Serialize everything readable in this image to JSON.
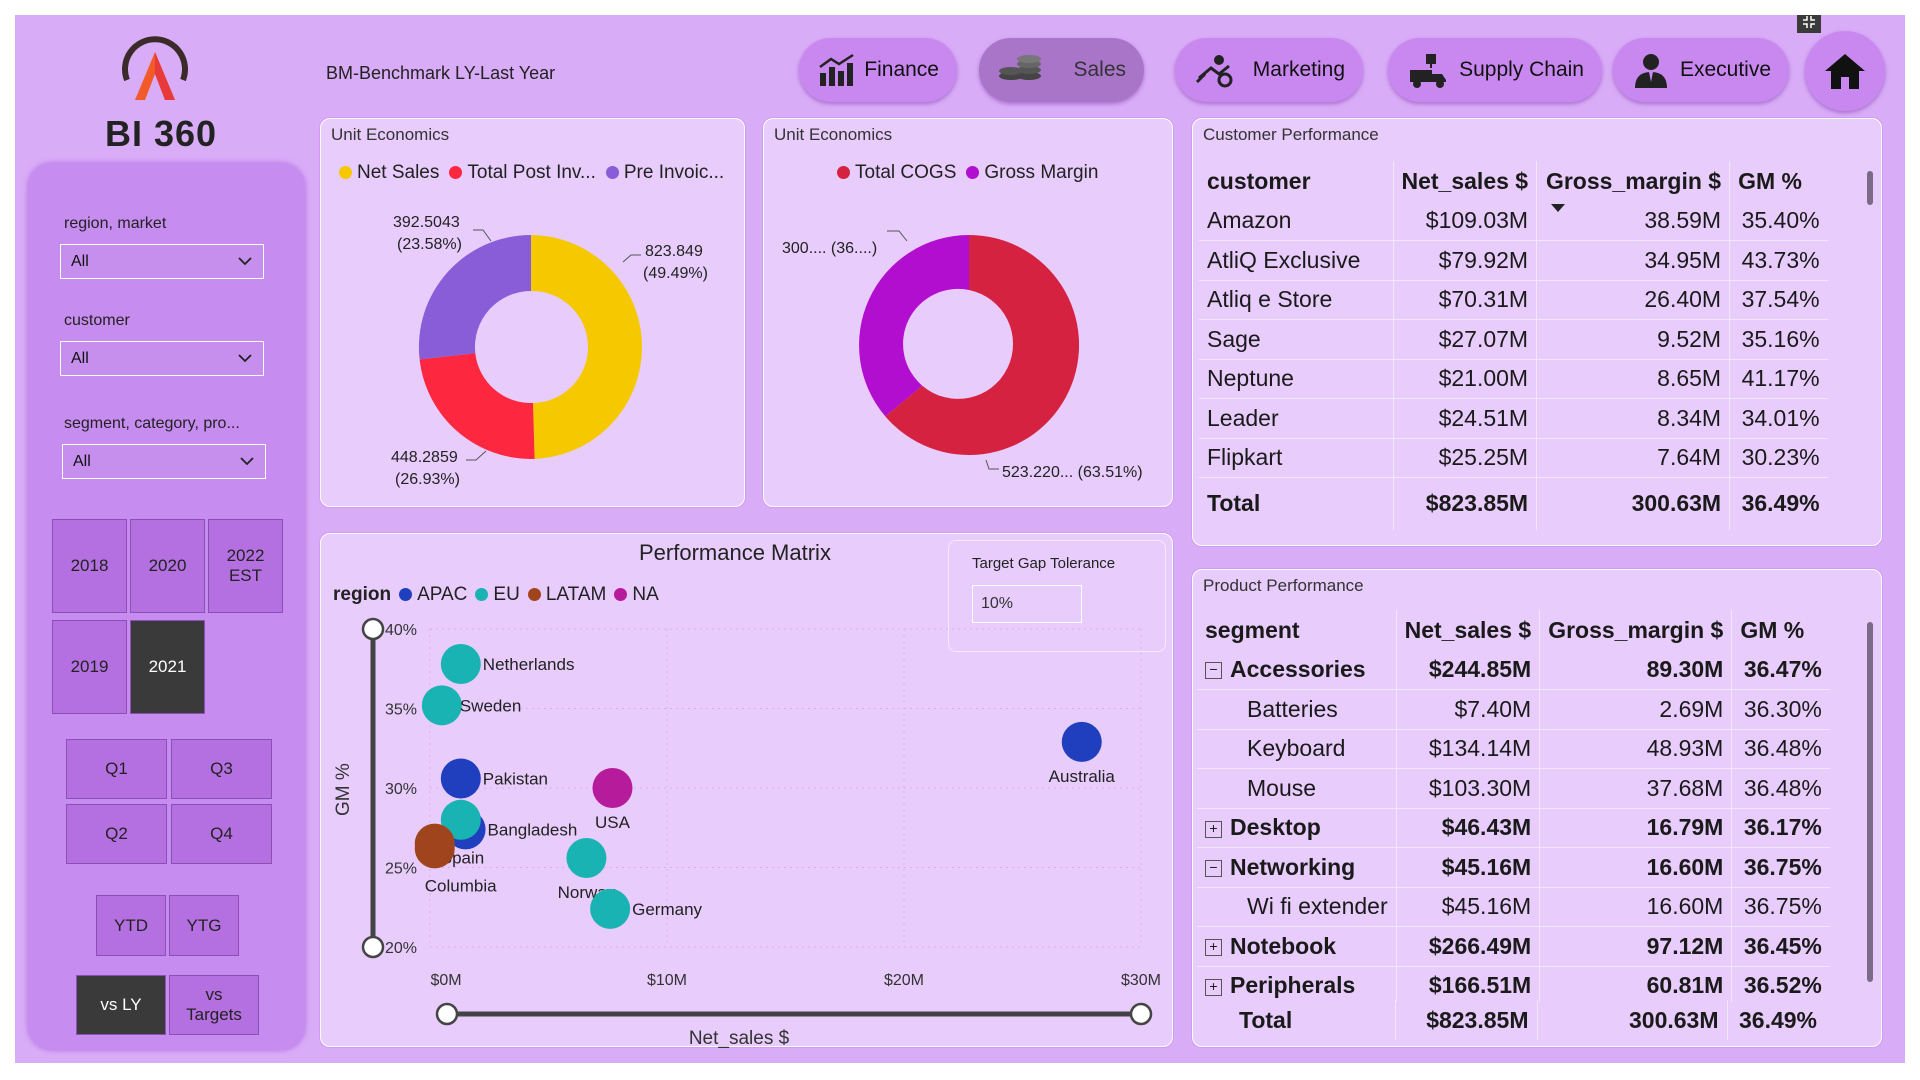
{
  "app": {
    "logo_text": "BI 360",
    "benchmark_note": "BM-Benchmark LY-Last Year"
  },
  "nav": [
    {
      "label": "Finance",
      "icon": "finance-chart-icon"
    },
    {
      "label": "Sales",
      "icon": "coins-icon"
    },
    {
      "label": "Marketing",
      "icon": "marketing-icon"
    },
    {
      "label": "Supply Chain",
      "icon": "supply-chain-icon"
    },
    {
      "label": "Executive",
      "icon": "executive-icon"
    },
    {
      "label": "",
      "icon": "home-icon"
    }
  ],
  "filters": {
    "region": {
      "label": "region, market",
      "value": "All"
    },
    "customer": {
      "label": "customer",
      "value": "All"
    },
    "segment": {
      "label": "segment, category, pro...",
      "value": "All"
    }
  },
  "years": [
    "2018",
    "2020",
    "2022 EST",
    "2019",
    "2021"
  ],
  "selected_year": "2021",
  "quarters": [
    "Q1",
    "Q3",
    "Q2",
    "Q4"
  ],
  "periods": [
    "YTD",
    "YTG"
  ],
  "compare": [
    "vs LY",
    "vs Targets"
  ],
  "selected_compare": "vs LY",
  "colors": {
    "accent": "#d9acf7",
    "yellow": "#f5c800",
    "red": "#fd2740",
    "violet": "#8a5dd8",
    "cogs": "#d42240",
    "margin": "#b10ed0",
    "apac": "#1f3fbf",
    "eu": "#19b3b3",
    "latam": "#a0441e",
    "na": "#b51b9a"
  },
  "unit_econ_1": {
    "title": "Unit Economics",
    "legend": [
      "Net Sales",
      "Total Post Inv...",
      "Pre Invoic..."
    ],
    "labels": {
      "net_sales": [
        "823.849",
        "(49.49%)"
      ],
      "post_inv": [
        "448.2859",
        "(26.93%)"
      ],
      "pre_inv": [
        "392.5043",
        "(23.58%)"
      ]
    }
  },
  "unit_econ_2": {
    "title": "Unit Economics",
    "legend": [
      "Total COGS",
      "Gross Margin"
    ],
    "labels": {
      "cogs": "523.220... (63.51%)",
      "margin": "300.... (36....)"
    }
  },
  "customer_perf": {
    "title": "Customer Performance",
    "columns": [
      "customer",
      "Net_sales $",
      "Gross_margin $",
      "GM %"
    ],
    "rows": [
      [
        "Amazon",
        "$109.03M",
        "38.59M",
        "35.40%"
      ],
      [
        "AtliQ Exclusive",
        "$79.92M",
        "34.95M",
        "43.73%"
      ],
      [
        "Atliq e Store",
        "$70.31M",
        "26.40M",
        "37.54%"
      ],
      [
        "Sage",
        "$27.07M",
        "9.52M",
        "35.16%"
      ],
      [
        "Neptune",
        "$21.00M",
        "8.65M",
        "41.17%"
      ],
      [
        "Leader",
        "$24.51M",
        "8.34M",
        "34.01%"
      ],
      [
        "Flipkart",
        "$25.25M",
        "7.64M",
        "30.23%"
      ]
    ],
    "total": [
      "Total",
      "$823.85M",
      "300.63M",
      "36.49%"
    ]
  },
  "product_perf": {
    "title": "Product Performance",
    "columns": [
      "segment",
      "Net_sales $",
      "Gross_margin $",
      "GM %"
    ],
    "rows": [
      {
        "name": "Accessories",
        "vals": [
          "$244.85M",
          "89.30M",
          "36.47%"
        ],
        "level": 0,
        "exp": "−"
      },
      {
        "name": "Batteries",
        "vals": [
          "$7.40M",
          "2.69M",
          "36.30%"
        ],
        "level": 1,
        "exp": ""
      },
      {
        "name": "Keyboard",
        "vals": [
          "$134.14M",
          "48.93M",
          "36.48%"
        ],
        "level": 1,
        "exp": ""
      },
      {
        "name": "Mouse",
        "vals": [
          "$103.30M",
          "37.68M",
          "36.48%"
        ],
        "level": 1,
        "exp": ""
      },
      {
        "name": "Desktop",
        "vals": [
          "$46.43M",
          "16.79M",
          "36.17%"
        ],
        "level": 0,
        "exp": "+"
      },
      {
        "name": "Networking",
        "vals": [
          "$45.16M",
          "16.60M",
          "36.75%"
        ],
        "level": 0,
        "exp": "−"
      },
      {
        "name": "Wi fi extender",
        "vals": [
          "$45.16M",
          "16.60M",
          "36.75%"
        ],
        "level": 1,
        "exp": ""
      },
      {
        "name": "Notebook",
        "vals": [
          "$266.49M",
          "97.12M",
          "36.45%"
        ],
        "level": 0,
        "exp": "+"
      },
      {
        "name": "Peripherals",
        "vals": [
          "$166.51M",
          "60.81M",
          "36.52%"
        ],
        "level": 0,
        "exp": "+"
      }
    ],
    "total": [
      "Total",
      "$823.85M",
      "300.63M",
      "36.49%"
    ]
  },
  "matrix": {
    "title": "Performance Matrix",
    "legend_title": "region",
    "tolerance_label": "Target Gap Tolerance",
    "tolerance_value": "10%"
  },
  "chart_data": [
    {
      "type": "pie",
      "title": "Unit Economics",
      "categories": [
        "Net Sales",
        "Total Post Inv...",
        "Pre Invoic..."
      ],
      "values": [
        823.849,
        448.2859,
        392.5043
      ],
      "percentages": [
        49.49,
        26.93,
        23.58
      ]
    },
    {
      "type": "pie",
      "title": "Unit Economics",
      "categories": [
        "Total COGS",
        "Gross Margin"
      ],
      "values": [
        523.22,
        300.63
      ],
      "percentages": [
        63.51,
        36.49
      ]
    },
    {
      "type": "scatter",
      "title": "Performance Matrix",
      "xlabel": "Net_sales $",
      "ylabel": "GM %",
      "xlim": [
        0,
        30
      ],
      "ylim": [
        20,
        40
      ],
      "x_ticks": [
        "$0M",
        "$10M",
        "$20M",
        "$30M"
      ],
      "y_ticks": [
        "40%",
        "35%",
        "30%",
        "25%",
        "20%"
      ],
      "series": [
        {
          "name": "APAC",
          "points": [
            {
              "label": "Australia",
              "x": 27.5,
              "y": 32.9
            },
            {
              "label": "Pakistan",
              "x": 1.3,
              "y": 30.6
            },
            {
              "label": "Bangladesh",
              "x": 1.5,
              "y": 27.4
            }
          ]
        },
        {
          "name": "EU",
          "points": [
            {
              "label": "Netherlands",
              "x": 1.3,
              "y": 37.8
            },
            {
              "label": "Sweden",
              "x": 0.5,
              "y": 35.2
            },
            {
              "label": "Norway",
              "x": 6.6,
              "y": 25.6
            },
            {
              "label": "Germany",
              "x": 7.6,
              "y": 22.4
            },
            {
              "label": "",
              "x": 1.3,
              "y": 28.0
            }
          ]
        },
        {
          "name": "LATAM",
          "points": [
            {
              "label": "Spain",
              "x": 0.2,
              "y": 26.5
            },
            {
              "label": "Columbia",
              "x": 0.2,
              "y": 26.2
            }
          ]
        },
        {
          "name": "NA",
          "points": [
            {
              "label": "USA",
              "x": 7.7,
              "y": 30.0
            }
          ]
        }
      ]
    }
  ]
}
